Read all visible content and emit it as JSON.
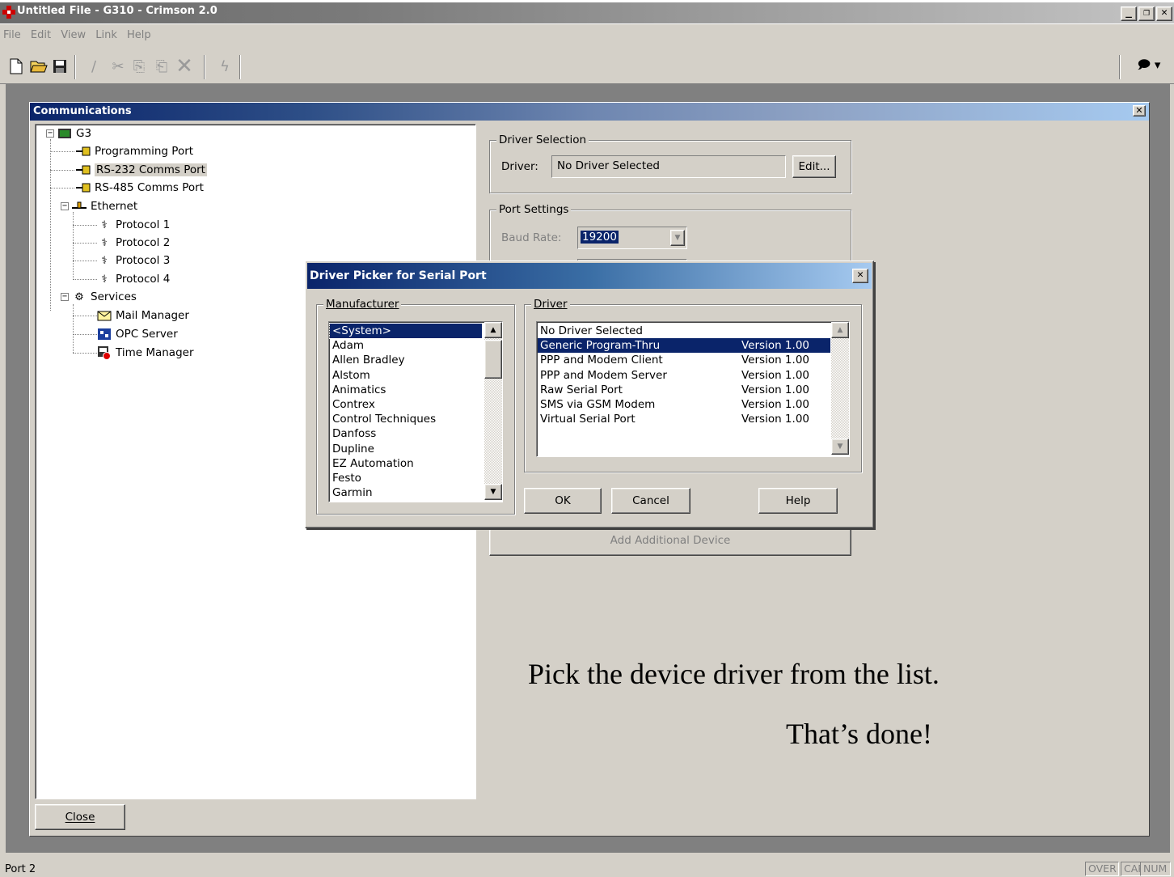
{
  "window": {
    "title": "Untitled File - G310 - Crimson 2.0"
  },
  "menubar": [
    "File",
    "Edit",
    "View",
    "Link",
    "Help"
  ],
  "toolbar": {
    "buttons": [
      "new-icon",
      "open-icon",
      "save-icon",
      "edit-icon",
      "cut-icon",
      "copy-icon",
      "paste-icon",
      "delete-icon",
      "send-icon"
    ],
    "right_button": "speech-balloon-icon"
  },
  "comm_window": {
    "title": "Communications",
    "close_label": "Close",
    "tree": {
      "root": "G3",
      "programming_port": "Programming Port",
      "rs232": "RS-232 Comms Port",
      "rs485": "RS-485 Comms Port",
      "ethernet": "Ethernet",
      "protocol1": "Protocol 1",
      "protocol2": "Protocol 2",
      "protocol3": "Protocol 3",
      "protocol4": "Protocol 4",
      "services": "Services",
      "mail_manager": "Mail Manager",
      "opc_server": "OPC Server",
      "time_manager": "Time Manager"
    },
    "driver_selection": {
      "group_label": "Driver Selection",
      "driver_label": "Driver:",
      "driver_value": "No Driver Selected",
      "edit_button": "Edit..."
    },
    "port_settings": {
      "group_label": "Port Settings",
      "baud_label": "Baud Rate:",
      "baud_value": "19200"
    },
    "add_device_button": "Add Additional Device"
  },
  "dialog": {
    "title": "Driver Picker for Serial Port",
    "manufacturer_label": "Manufacturer",
    "driver_label": "Driver",
    "manufacturers": [
      "<System>",
      "Adam",
      "Allen Bradley",
      "Alstom",
      "Animatics",
      "Contrex",
      "Control Techniques",
      "Danfoss",
      "Dupline",
      "EZ Automation",
      "Festo",
      "Garmin"
    ],
    "drivers": [
      {
        "name": "No Driver Selected",
        "version": ""
      },
      {
        "name": "Generic Program-Thru",
        "version": "Version 1.00"
      },
      {
        "name": "PPP and Modem Client",
        "version": "Version 1.00"
      },
      {
        "name": "PPP and Modem Server",
        "version": "Version 1.00"
      },
      {
        "name": "Raw Serial Port",
        "version": "Version 1.00"
      },
      {
        "name": "SMS via GSM Modem",
        "version": "Version 1.00"
      },
      {
        "name": "Virtual Serial Port",
        "version": "Version 1.00"
      }
    ],
    "ok": "OK",
    "cancel": "Cancel",
    "help": "Help"
  },
  "annotations": {
    "line1": "Pick the device driver from the list.",
    "line2": "That’s done!"
  },
  "statusbar": {
    "left": "Port 2",
    "over": "OVER",
    "caps": "CAPS",
    "num": "NUM"
  }
}
